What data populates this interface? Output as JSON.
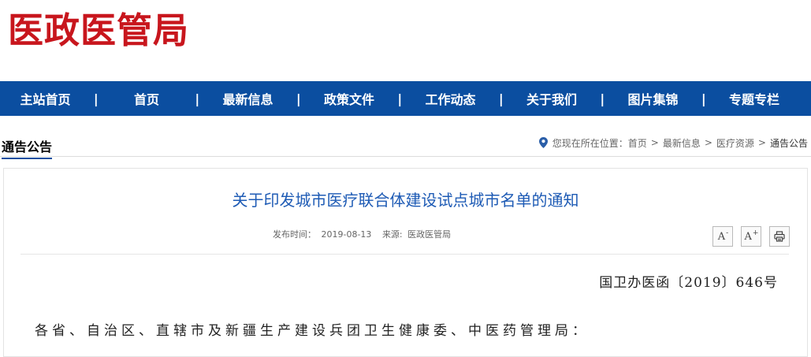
{
  "site": {
    "logo_text": "医政医管局"
  },
  "nav": {
    "items": [
      "主站首页",
      "首页",
      "最新信息",
      "政策文件",
      "工作动态",
      "关于我们",
      "图片集锦",
      "专题专栏"
    ],
    "separator": "|"
  },
  "section": {
    "title": "通告公告"
  },
  "breadcrumb": {
    "prefix": "您现在所在位置：",
    "items": [
      "首页",
      "最新信息",
      "医疗资源",
      "通告公告"
    ],
    "separator": ">"
  },
  "article": {
    "title": "关于印发城市医疗联合体建设试点城市名单的通知",
    "publish_label": "发布时间：",
    "publish_date": "2019-08-13",
    "source_label": "来源:",
    "source": "医政医管局",
    "doc_number": "国卫办医函〔2019〕646号",
    "salutation": "各省、自治区、直辖市及新疆生产建设兵团卫生健康委、中医药管理局："
  },
  "tools": {
    "decrease_label": "A",
    "decrease_mark": "-",
    "increase_label": "A",
    "increase_mark": "+"
  },
  "colors": {
    "logo": "#c8161d",
    "nav_bg": "#0b4ea0",
    "title": "#1e5bb5"
  }
}
